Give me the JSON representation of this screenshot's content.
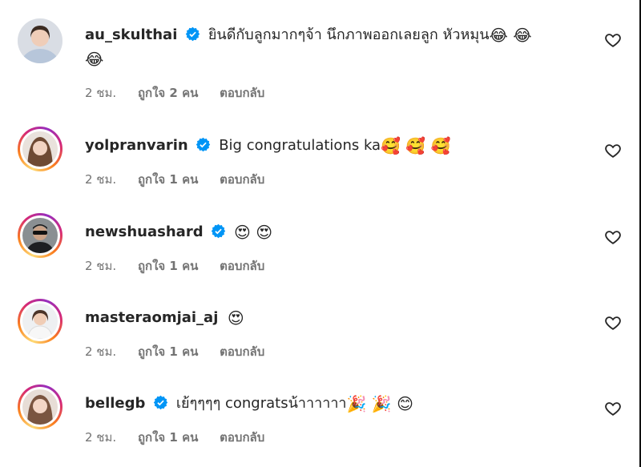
{
  "comments": [
    {
      "username": "au_skulthai",
      "verified": true,
      "text": "ยินดีกับลูกมากๆจ้า นึกภาพออกเลยลูก หัวหมุน",
      "emojis_line1": "😂 😂",
      "emojis_line2": "😂",
      "time": "2 ชม.",
      "likes": "ถูกใจ 2 คน",
      "reply": "ตอบกลับ",
      "avatar_ring": false
    },
    {
      "username": "yolpranvarin",
      "verified": true,
      "text": "Big congratulations ka",
      "emojis_line1": "🥰 🥰 🥰",
      "time": "2 ชม.",
      "likes": "ถูกใจ 1 คน",
      "reply": "ตอบกลับ",
      "avatar_ring": true
    },
    {
      "username": "newshuashard",
      "verified": true,
      "text": "",
      "emojis_line1": "😍 😍",
      "time": "2 ชม.",
      "likes": "ถูกใจ 1 คน",
      "reply": "ตอบกลับ",
      "avatar_ring": true
    },
    {
      "username": "masteraomjai_aj",
      "verified": false,
      "text": "",
      "emojis_line1": "😍",
      "time": "2 ชม.",
      "likes": "ถูกใจ 1 คน",
      "reply": "ตอบกลับ",
      "avatar_ring": true
    },
    {
      "username": "bellegb",
      "verified": true,
      "text": "เย้ๆๆๆๆ congratsน้าาาาาา",
      "emojis_line1": "🎉 🎉 😊",
      "time": "2 ชม.",
      "likes": "ถูกใจ 1 คน",
      "reply": "ตอบกลับ",
      "avatar_ring": true
    }
  ],
  "colors": {
    "text": "#262626",
    "meta": "#737373",
    "verified": "#0095f6"
  }
}
